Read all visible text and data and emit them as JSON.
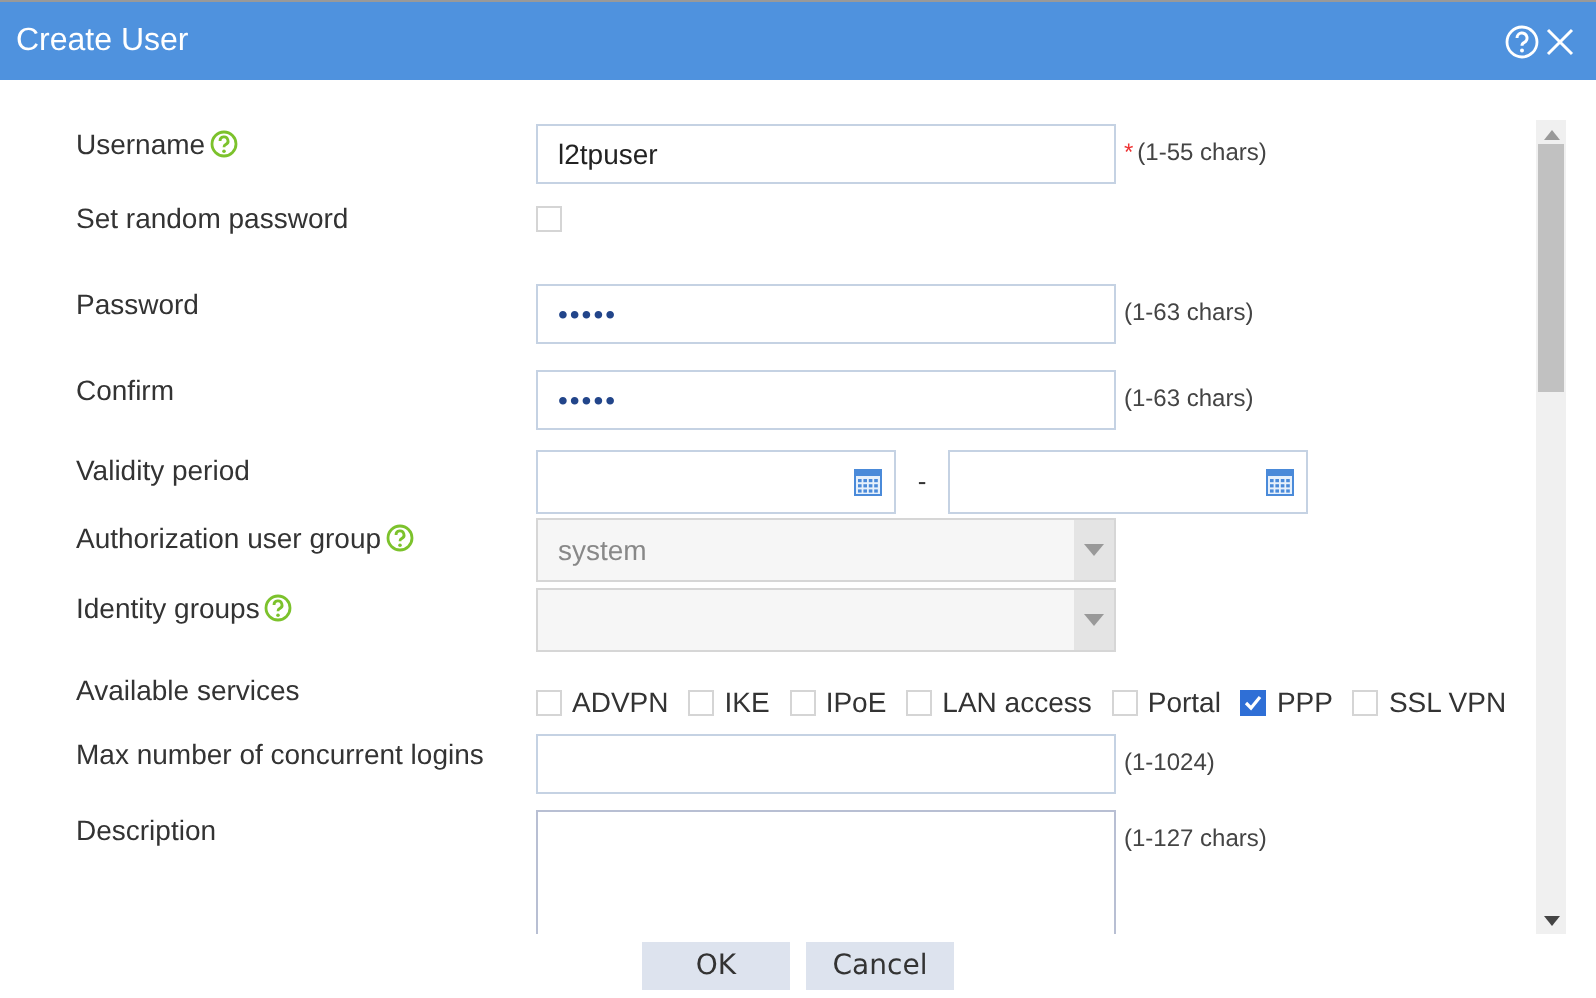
{
  "window": {
    "title": "Create User"
  },
  "fields": [
    {
      "kind": "text",
      "label": "Username",
      "help": true,
      "value": "l2tpuser",
      "required_mark": "*",
      "hint": "(1-55 chars)"
    },
    {
      "kind": "checkbox",
      "label": "Set random password",
      "help": false,
      "checked": false
    },
    {
      "kind": "text",
      "label": "Password",
      "help": false,
      "value": "•••••",
      "hint": "(1-63 chars)"
    },
    {
      "kind": "text",
      "label": "Confirm",
      "help": false,
      "value": "•••••",
      "hint": "(1-63 chars)"
    },
    {
      "kind": "daterange",
      "label": "Validity period",
      "help": false,
      "separator": "-"
    },
    {
      "kind": "select",
      "label": "Authorization user group",
      "help": true,
      "value": "system",
      "disabled": true
    },
    {
      "kind": "select",
      "label": "Identity groups",
      "help": true,
      "disabled": true
    },
    {
      "kind": "services",
      "label": "Available services",
      "help": false,
      "options": [
        {
          "label": "ADVPN",
          "checked": false
        },
        {
          "label": "IKE",
          "checked": false
        },
        {
          "label": "IPoE",
          "checked": false
        },
        {
          "label": "LAN access",
          "checked": false
        },
        {
          "label": "Portal",
          "checked": false
        },
        {
          "label": "PPP",
          "checked": true
        },
        {
          "label": "SSL VPN",
          "checked": false
        }
      ]
    },
    {
      "kind": "text",
      "label": "Max number of concurrent logins",
      "help": false,
      "hint": "(1-1024)"
    },
    {
      "kind": "textarea",
      "label": "Description",
      "help": false,
      "hint": "(1-127 chars)"
    }
  ],
  "buttons": [
    "OK",
    "Cancel"
  ]
}
